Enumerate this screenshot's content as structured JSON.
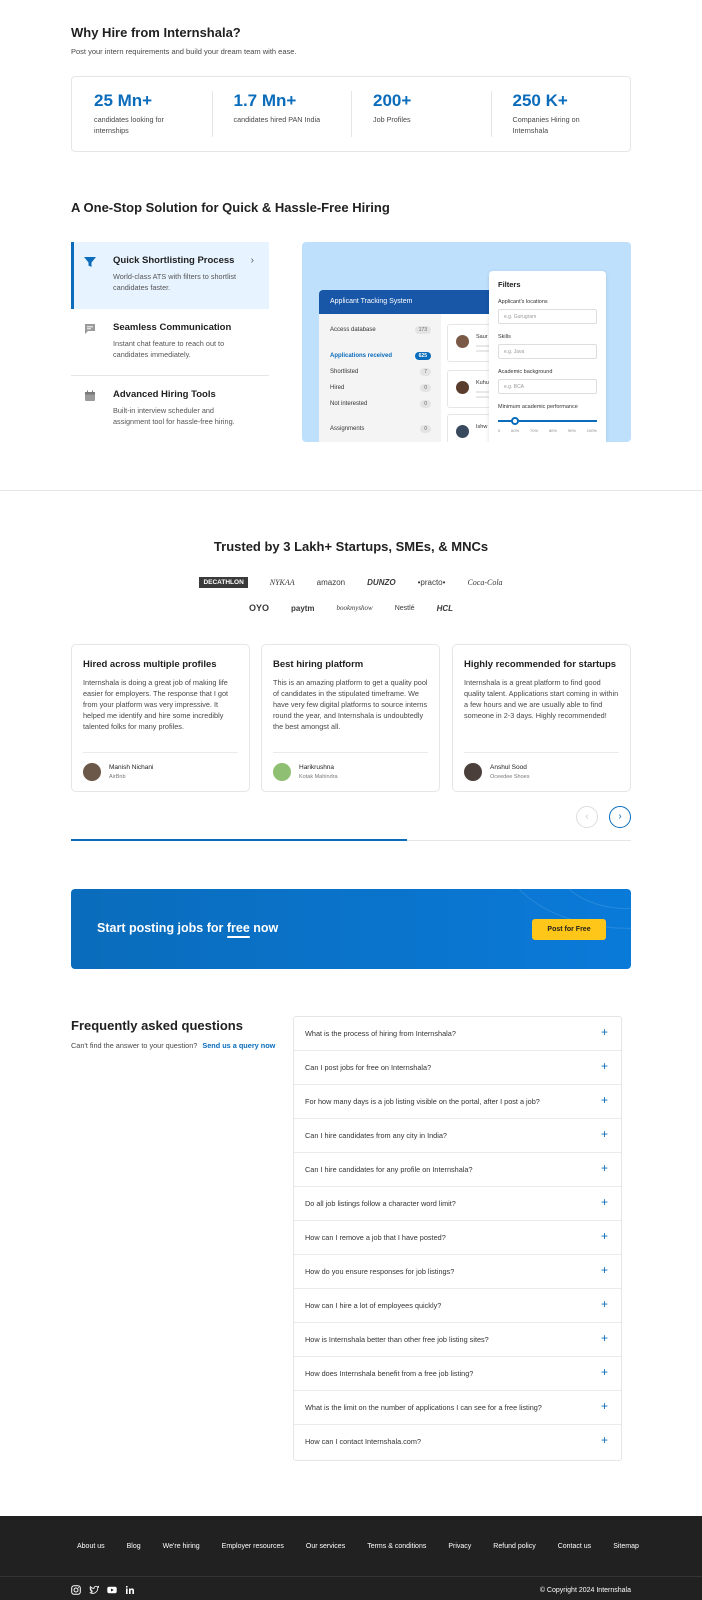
{
  "why_hire": {
    "title": "Why Hire from Internshala?",
    "subtitle": "Post your intern requirements and build your dream team with ease.",
    "stats": [
      {
        "value": "25 Mn+",
        "label": "candidates looking for internships"
      },
      {
        "value": "1.7 Mn+",
        "label": "candidates hired PAN India"
      },
      {
        "value": "200+",
        "label": "Job Profiles"
      },
      {
        "value": "250 K+",
        "label": "Companies Hiring on Internshala"
      }
    ]
  },
  "one_stop": {
    "title": "A One-Stop Solution for Quick & Hassle-Free Hiring",
    "features": [
      {
        "title": "Quick Shortlisting Process",
        "desc": "World-class ATS with filters to shortlist candidates faster.",
        "icon": "filter-icon"
      },
      {
        "title": "Seamless Communication",
        "desc": "Instant chat feature to reach out to candidates immediately.",
        "icon": "chat-icon"
      },
      {
        "title": "Advanced Hiring Tools",
        "desc": "Built-in interview scheduler and assignment tool for hassle-free hiring.",
        "icon": "calendar-icon"
      }
    ],
    "illustration": {
      "ats_title": "Applicant Tracking System",
      "rows": [
        {
          "label": "Access database",
          "count": "173"
        },
        {
          "label": "Applications received",
          "count": "625"
        },
        {
          "label": "Shortlisted",
          "count": "7"
        },
        {
          "label": "Hired",
          "count": "0"
        },
        {
          "label": "Not interested",
          "count": "0"
        },
        {
          "label": "Assignments",
          "count": "0"
        }
      ],
      "candidates": [
        "Saur",
        "Kuhu",
        "Ishw"
      ],
      "filters": {
        "title": "Filters",
        "fields": [
          {
            "label": "Applicant's locations",
            "placeholder": "e.g. Gurugram"
          },
          {
            "label": "Skills",
            "placeholder": "e.g. Java"
          },
          {
            "label": "Academic background",
            "placeholder": "e.g. BCA"
          }
        ],
        "slider_label": "Minimum academic performance",
        "slider_ticks": [
          "0",
          "60%",
          "70%",
          "80%",
          "90%",
          "100%"
        ],
        "slider_value_percent": 60
      }
    }
  },
  "trusted": {
    "title": "Trusted by 3 Lakh+ Startups, SMEs, & MNCs",
    "logos_row1": [
      "DECATHLON",
      "NYKAA",
      "amazon",
      "DUNZO",
      "•practo•",
      "Coca-Cola"
    ],
    "logos_row2": [
      "OYO",
      "paytm",
      "bookmyshow",
      "Nestlé",
      "HCL"
    ]
  },
  "testimonials": [
    {
      "title": "Hired across multiple profiles",
      "body": "Internshala is doing a great job of making life easier for employers. The response that I got from your platform was very impressive. It helped me identify and hire some incredibly talented folks for many profiles.",
      "name": "Manish Nichani",
      "org": "AirBnb"
    },
    {
      "title": "Best hiring platform",
      "body": "This is an amazing platform to get a quality pool of candidates in the stipulated timeframe. We have very few digital platforms to source interns round the year, and Internshala is undoubtedly the best amongst all.",
      "name": "Harikrushna",
      "org": "Kotak Mahindra"
    },
    {
      "title": "Highly recommended for startups",
      "body": "Internshala is a great platform to find good quality talent. Applications start coming in within a few hours and we are usually able to find someone in 2-3 days. Highly recommended!",
      "name": "Anshul Sood",
      "org": "Oceedee Shoes"
    }
  ],
  "carousel": {
    "prev": "‹",
    "next": "›",
    "progress_fraction": 0.6
  },
  "cta": {
    "text_before": "Start posting jobs for ",
    "text_free": "free",
    "text_after": " now",
    "button": "Post for Free"
  },
  "faq": {
    "title": "Frequently asked questions",
    "subtitle": "Can't find the answer to your question?",
    "link": "Send us a query now",
    "plus": "+",
    "questions": [
      "What is the process of hiring from Internshala?",
      "Can I post jobs for free on Internshala?",
      "For how many days is a job listing visible on the portal, after I post a job?",
      "Can I hire candidates from any city in India?",
      "Can I hire candidates for any profile on Internshala?",
      "Do all job listings follow a character word limit?",
      "How can I remove a job that I have posted?",
      "How do you ensure responses for job listings?",
      "How can I hire a lot of employees quickly?",
      "How is Internshala better than other free job listing sites?",
      "How does Internshala benefit from a free job listing?",
      "What is the limit on the number of applications I can see for a free listing?",
      "How can I contact Internshala.com?"
    ]
  },
  "footer": {
    "links": [
      "About us",
      "Blog",
      "We're hiring",
      "Employer resources",
      "Our services",
      "Terms & conditions",
      "Privacy",
      "Refund policy",
      "Contact us",
      "Sitemap"
    ],
    "social_icons": [
      "instagram-icon",
      "twitter-icon",
      "youtube-icon",
      "linkedin-icon"
    ],
    "copyright": "© Copyright 2024 Internshala"
  }
}
